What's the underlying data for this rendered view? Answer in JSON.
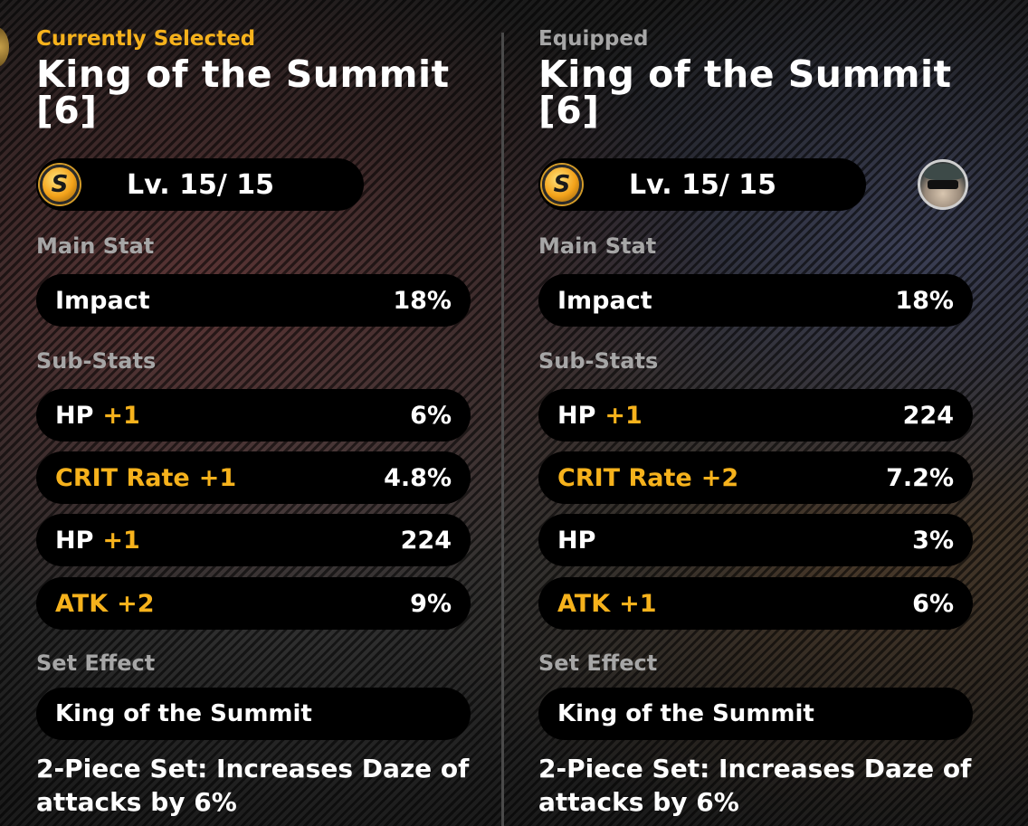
{
  "left": {
    "header": "Currently Selected",
    "title": "King of the Summit [6]",
    "rank_icon": "S",
    "level": "Lv. 15/ 15",
    "main_stat_label": "Main Stat",
    "main_stat": {
      "name": "Impact",
      "value": "18%"
    },
    "sub_stats_label": "Sub-Stats",
    "sub_stats": [
      {
        "name": "HP",
        "roll": "+1",
        "value": "6%",
        "highlight": false
      },
      {
        "name": "CRIT Rate",
        "roll": "+1",
        "value": "4.8%",
        "highlight": true
      },
      {
        "name": "HP",
        "roll": "+1",
        "value": "224",
        "highlight": false
      },
      {
        "name": "ATK",
        "roll": "+2",
        "value": "9%",
        "highlight": true
      }
    ],
    "set_effect_label": "Set Effect",
    "set_name": "King of the Summit",
    "set_desc": "2-Piece Set: Increases Daze of attacks by 6%"
  },
  "right": {
    "header": "Equipped",
    "title": "King of the Summit [6]",
    "rank_icon": "S",
    "level": "Lv. 15/ 15",
    "avatar_icon": "agent-avatar-icon",
    "main_stat_label": "Main Stat",
    "main_stat": {
      "name": "Impact",
      "value": "18%"
    },
    "sub_stats_label": "Sub-Stats",
    "sub_stats": [
      {
        "name": "HP",
        "roll": "+1",
        "value": "224",
        "highlight": false
      },
      {
        "name": "CRIT Rate",
        "roll": "+2",
        "value": "7.2%",
        "highlight": true
      },
      {
        "name": "HP",
        "roll": "",
        "value": "3%",
        "highlight": false
      },
      {
        "name": "ATK",
        "roll": "+1",
        "value": "6%",
        "highlight": true
      }
    ],
    "set_effect_label": "Set Effect",
    "set_name": "King of the Summit",
    "set_desc": "2-Piece Set: Increases Daze of attacks by 6%"
  },
  "colors": {
    "accent": "#f6b21c",
    "muted": "#a6a6a6",
    "pill": "#000000"
  }
}
